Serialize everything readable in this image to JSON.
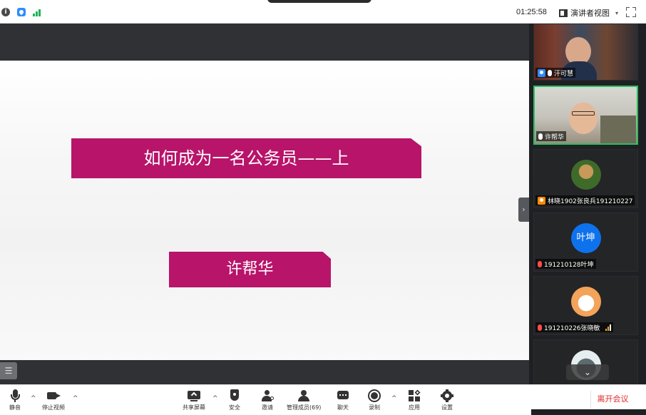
{
  "topbar": {
    "timer": "01:25:58",
    "view_label": "演讲者视图",
    "view_caret": "▾",
    "info_glyph": "i"
  },
  "slide": {
    "title": "如何成为一名公务员——上",
    "presenter": "许帮华"
  },
  "controls": {
    "list_toggle_glyph": "☰",
    "side_toggle_glyph": "›",
    "scroll_down_glyph": "⌄"
  },
  "participants": [
    {
      "name": "汗可慧",
      "mic": "on",
      "video": true
    },
    {
      "name": "许帮华",
      "mic": "on",
      "video": true,
      "active": true
    },
    {
      "name": "林晓1902张良兵191210227",
      "mic": "none",
      "video": false
    },
    {
      "name": "191210128叶坤",
      "mic": "muted",
      "video": false,
      "avatar_text": "叶坤"
    },
    {
      "name": "191210226张晓敏",
      "mic": "muted",
      "video": false
    },
    {
      "name": "",
      "mic": "none",
      "video": false
    }
  ],
  "toolbar": {
    "mute": "静音",
    "stop_video": "停止视频",
    "share_screen": "共享屏幕",
    "security": "安全",
    "invite": "邀请",
    "manage_participants": "管理成员(69)",
    "chat": "聊天",
    "record": "录制",
    "apps": "应用",
    "settings": "设置",
    "leave": "离开会议",
    "caret_up": "^"
  },
  "colors": {
    "slide_accent": "#b7146a",
    "active_border": "#2dbe60",
    "leave_red": "#e02828",
    "avatar_blue": "#0e72ed"
  }
}
